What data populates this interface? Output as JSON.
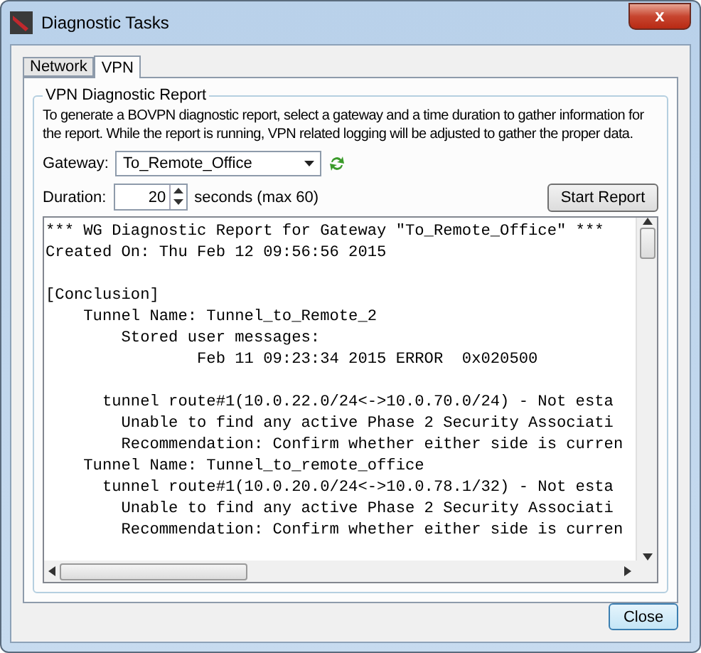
{
  "window": {
    "title": "Diagnostic Tasks",
    "close": "x"
  },
  "tabs": [
    {
      "label": "Network",
      "selected": false
    },
    {
      "label": "VPN",
      "selected": true
    }
  ],
  "group": {
    "title": "VPN Diagnostic Report",
    "description": "To generate a BOVPN diagnostic report, select a gateway and a time duration to gather information for the report. While the report is running, VPN related logging will be adjusted to gather the proper data.",
    "gateway": {
      "label": "Gateway:",
      "value": "To_Remote_Office"
    },
    "duration": {
      "label": "Duration:",
      "value": "20",
      "hint": "seconds (max 60)"
    },
    "start_button": "Start Report",
    "report": [
      [
        "*** WG Diagnostic Report for Gateway \"To_Remote_Office\" ***",
        "Created On: Thu Feb 12 09:56:56 2015"
      ],
      [
        "[Conclusion]",
        "    Tunnel Name: Tunnel_to_Remote_2",
        "        Stored user messages:",
        "                Feb 11 09:23:34 2015 ERROR  0x020500"
      ],
      [
        "      tunnel route#1(10.0.22.0/24<->10.0.70.0/24) - Not esta",
        "        Unable to find any active Phase 2 Security Associati",
        "        Recommendation: Confirm whether either side is curren",
        "    Tunnel Name: Tunnel_to_remote_office",
        "      tunnel route#1(10.0.20.0/24<->10.0.78.1/32) - Not esta",
        "        Unable to find any active Phase 2 Security Associati",
        "        Recommendation: Confirm whether either side is curren"
      ]
    ]
  },
  "close_button": "Close"
}
